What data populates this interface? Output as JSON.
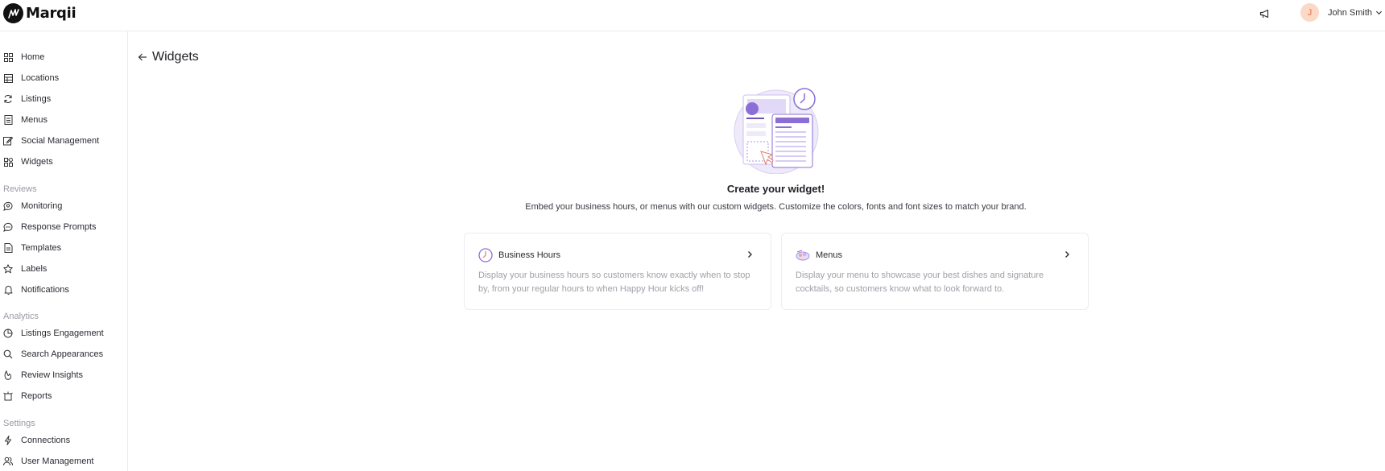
{
  "brand": {
    "name": "Marqii"
  },
  "header": {
    "user_initial": "J",
    "user_name": "John Smith"
  },
  "sidebar": {
    "main": [
      {
        "label": "Home",
        "icon": "grid-icon"
      },
      {
        "label": "Locations",
        "icon": "table-icon"
      },
      {
        "label": "Listings",
        "icon": "sync-icon"
      },
      {
        "label": "Menus",
        "icon": "menu-book-icon"
      },
      {
        "label": "Social Management",
        "icon": "edit-square-icon"
      },
      {
        "label": "Widgets",
        "icon": "widgets-icon"
      }
    ],
    "reviews_title": "Reviews",
    "reviews": [
      {
        "label": "Monitoring",
        "icon": "chat-search-icon"
      },
      {
        "label": "Response Prompts",
        "icon": "chat-dots-icon"
      },
      {
        "label": "Templates",
        "icon": "document-icon"
      },
      {
        "label": "Labels",
        "icon": "star-icon"
      },
      {
        "label": "Notifications",
        "icon": "bell-icon"
      }
    ],
    "analytics_title": "Analytics",
    "analytics": [
      {
        "label": "Listings Engagement",
        "icon": "pie-chart-icon"
      },
      {
        "label": "Search Appearances",
        "icon": "search-icon"
      },
      {
        "label": "Review Insights",
        "icon": "bulb-icon"
      },
      {
        "label": "Reports",
        "icon": "report-icon"
      }
    ],
    "settings_title": "Settings",
    "settings": [
      {
        "label": "Connections",
        "icon": "bolt-icon"
      },
      {
        "label": "User Management",
        "icon": "users-icon"
      }
    ]
  },
  "page": {
    "title": "Widgets",
    "headline": "Create your widget!",
    "subline": "Embed your business hours, or menus with our custom widgets. Customize the colors, fonts and font sizes to match your brand."
  },
  "cards": [
    {
      "title": "Business Hours",
      "icon": "clock-icon",
      "description": "Display your business hours so customers know exactly when to stop by, from your regular hours to when Happy Hour kicks off!"
    },
    {
      "title": "Menus",
      "icon": "food-icon",
      "description": "Display your menu to showcase your best dishes and signature cocktails, so customers know what to look forward to."
    }
  ],
  "colors": {
    "accent": "#8b6fd6",
    "avatar_bg": "#fcd8c6",
    "border": "#ececf0",
    "muted": "#9a9aa3"
  }
}
